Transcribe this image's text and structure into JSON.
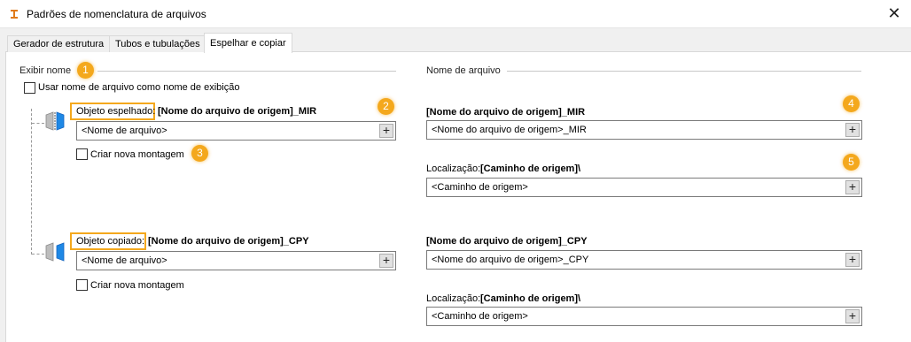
{
  "window": {
    "title": "Padrões de nomenclatura de arquivos",
    "close_glyph": "✕"
  },
  "tabs": [
    {
      "label": "Gerador de estrutura",
      "active": false
    },
    {
      "label": "Tubos e tubulações",
      "active": false
    },
    {
      "label": "Espelhar e copiar",
      "active": true
    }
  ],
  "left": {
    "section_title": "Exibir nome",
    "use_filename_checkbox": {
      "label": "Usar nome de arquivo como nome de exibição",
      "checked": false
    },
    "mirrored": {
      "label": "Objeto espelhado:",
      "pattern": "[Nome do arquivo de origem]_MIR",
      "field_value": "<Nome de arquivo>",
      "new_assembly": {
        "label": "Criar nova montagem",
        "checked": false
      }
    },
    "copied": {
      "label": "Objeto copiado:",
      "pattern": "[Nome do arquivo de origem]_CPY",
      "field_value": "<Nome de arquivo>",
      "new_assembly": {
        "label": "Criar nova montagem",
        "checked": false
      }
    }
  },
  "right": {
    "section_title": "Nome de arquivo",
    "mirrored": {
      "pattern": "[Nome do arquivo de origem]_MIR",
      "field_value": "<Nome do arquivo de origem>_MIR",
      "location_label": "Localização:",
      "location_pattern": "[Caminho de origem]\\",
      "location_value": "<Caminho de origem>"
    },
    "copied": {
      "pattern": "[Nome do arquivo de origem]_CPY",
      "field_value": "<Nome do arquivo de origem>_CPY",
      "location_label": "Localização:",
      "location_pattern": "[Caminho de origem]\\",
      "location_value": "<Caminho de origem>"
    }
  },
  "plus_glyph": "+",
  "callouts": [
    "1",
    "2",
    "3",
    "4",
    "5"
  ],
  "colors": {
    "callout": "#f4a81d",
    "file_icon_blue": "#1e88e5",
    "file_icon_gray": "#9e9e9e"
  }
}
